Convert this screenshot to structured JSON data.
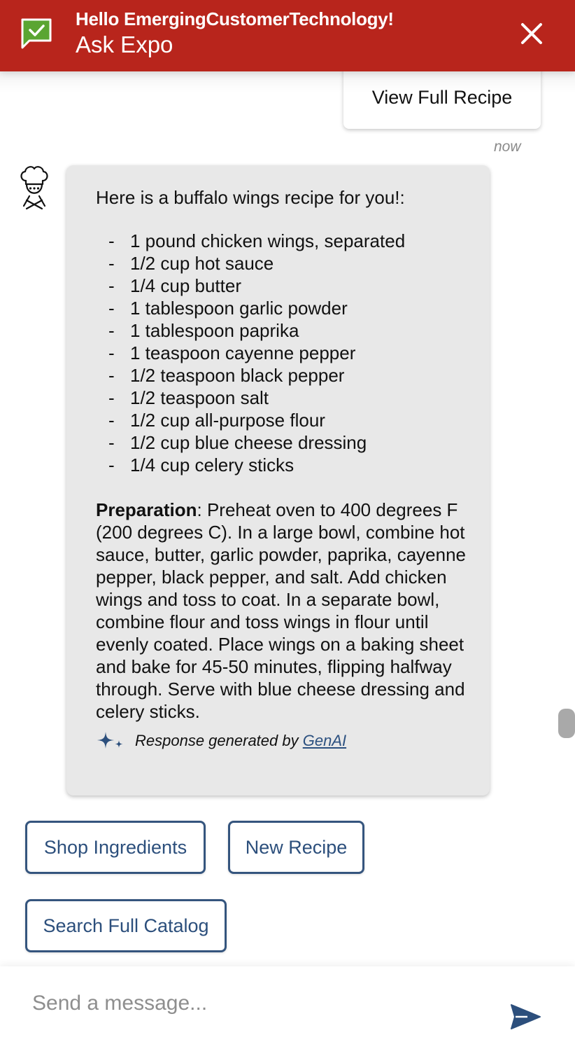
{
  "header": {
    "greeting": "Hello EmergingCustomerTechnology!",
    "title": "Ask Expo"
  },
  "messages": {
    "view_recipe_label": "View Full Recipe",
    "timestamp": "now",
    "intro": "Here is a buffalo wings recipe for you!:",
    "ingredients": [
      "1 pound chicken wings, separated",
      "1/2 cup hot sauce",
      "1/4 cup butter",
      "1 tablespoon garlic powder",
      "1 tablespoon paprika",
      "1 teaspoon cayenne pepper",
      "1/2 teaspoon black pepper",
      "1/2 teaspoon salt",
      "1/2 cup all-purpose flour",
      "1/2 cup blue cheese dressing",
      "1/4 cup celery sticks"
    ],
    "bullet": "-",
    "preparation_label": "Preparation",
    "preparation_sep": ":",
    "preparation_text": " Preheat oven to 400 degrees F (200 degrees C). In a large bowl, combine hot sauce, butter, garlic powder, paprika, cayenne pepper, black pepper, and salt. Add chicken wings and toss to coat. In a separate bowl, combine flour and toss wings in flour until evenly coated. Place wings on a baking sheet and bake for 45-50 minutes, flipping halfway through. Serve with blue cheese dressing and celery sticks.",
    "genai_prefix": "Response generated by ",
    "genai_link": "GenAI"
  },
  "quick_replies": {
    "shop": "Shop Ingredients",
    "new_recipe": "New Recipe",
    "catalog": "Search Full Catalog"
  },
  "composer": {
    "placeholder": "Send a message..."
  },
  "colors": {
    "header_bg": "#b8251c",
    "chip_border": "#35557e",
    "bubble_bg": "#e8e8e8",
    "chat_icon_green": "#5aa532"
  },
  "icons": {
    "header": "chat-check-icon",
    "close": "close-icon",
    "avatar": "chef-icon",
    "genai": "sparkle-icon",
    "send": "send-icon"
  }
}
